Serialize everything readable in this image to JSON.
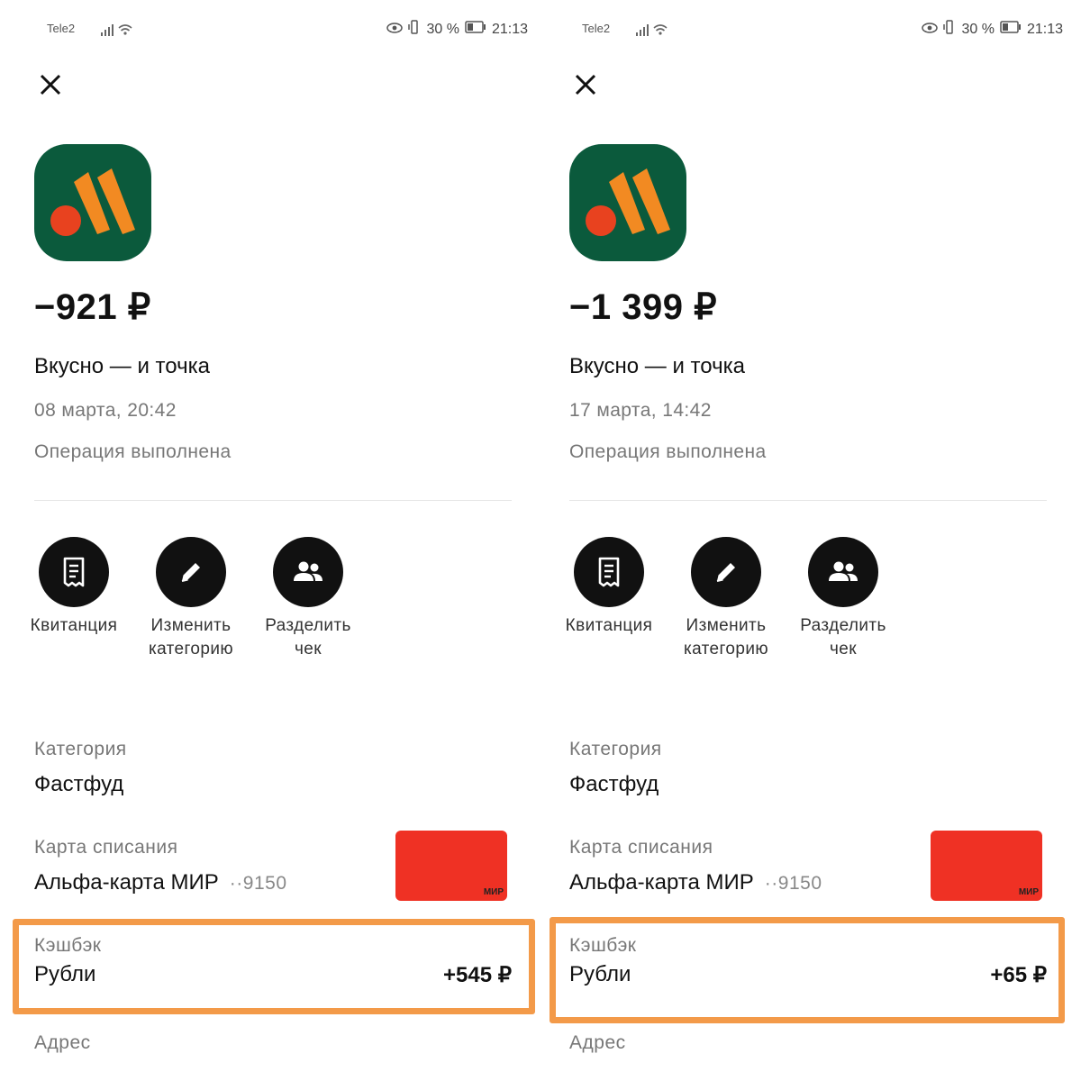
{
  "screens": [
    {
      "status_bar": {
        "carrier": "Tele2",
        "battery": "30 %",
        "time": "21:13"
      },
      "amount": "−921 ₽",
      "merchant": "Вкусно — и точка",
      "date": "08 марта, 20:42",
      "status": "Операция выполнена",
      "actions": [
        {
          "label": "Квитанция",
          "icon": "receipt-icon"
        },
        {
          "label": "Изменить категорию",
          "icon": "pencil-icon"
        },
        {
          "label": "Разделить чек",
          "icon": "people-icon"
        }
      ],
      "category": {
        "label": "Категория",
        "value": "Фастфуд"
      },
      "card": {
        "label": "Карта списания",
        "value": "Альфа-карта МИР",
        "suffix": "··9150",
        "brand": "МИР"
      },
      "cashback": {
        "label": "Кэшбэк",
        "type": "Рубли",
        "amount": "+545 ₽"
      },
      "address": {
        "label": "Адрес"
      }
    },
    {
      "status_bar": {
        "carrier": "Tele2",
        "battery": "30 %",
        "time": "21:13"
      },
      "amount": "−1 399 ₽",
      "merchant": "Вкусно — и точка",
      "date": "17 марта, 14:42",
      "status": "Операция выполнена",
      "actions": [
        {
          "label": "Квитанция",
          "icon": "receipt-icon"
        },
        {
          "label": "Изменить категорию",
          "icon": "pencil-icon"
        },
        {
          "label": "Разделить чек",
          "icon": "people-icon"
        }
      ],
      "category": {
        "label": "Категория",
        "value": "Фастфуд"
      },
      "card": {
        "label": "Карта списания",
        "value": "Альфа-карта МИР",
        "suffix": "··9150",
        "brand": "МИР"
      },
      "cashback": {
        "label": "Кэшбэк",
        "type": "Рубли",
        "amount": "+65 ₽"
      },
      "address": {
        "label": "Адрес"
      }
    }
  ],
  "colors": {
    "logo_bg": "#0b5a3c",
    "logo_orange": "#f28a22",
    "logo_red": "#e8421f",
    "card_red": "#ef3124",
    "highlight": "#f39a49",
    "action_circle": "#111111"
  }
}
